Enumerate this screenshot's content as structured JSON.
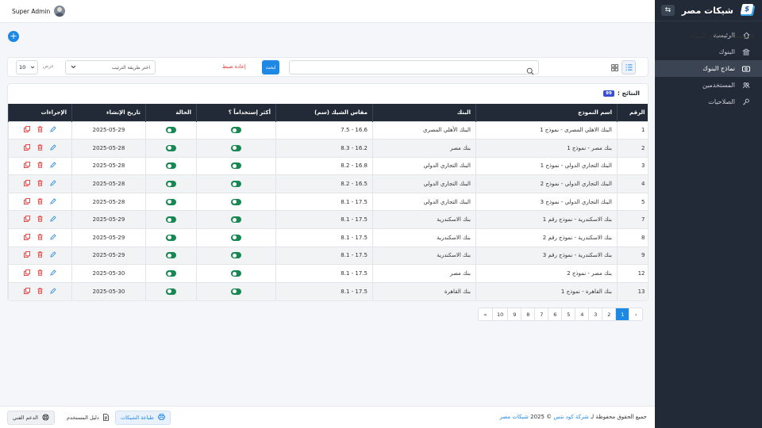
{
  "brand": {
    "name": "شيكات مصر"
  },
  "sidebar": {
    "items": [
      {
        "label": "الرئيسية",
        "icon": "home-icon"
      },
      {
        "label": "البنوك",
        "icon": "bank-icon"
      },
      {
        "label": "نماذج البنوك",
        "icon": "cheque-icon",
        "active": true
      },
      {
        "label": "المستخدمين",
        "icon": "users-icon"
      },
      {
        "label": "الصلاحيات",
        "icon": "key-icon"
      }
    ]
  },
  "topbar": {
    "user_name": "Super Admin"
  },
  "page": {
    "title": "الرئيسية - نماذج البنوك"
  },
  "filter": {
    "search_placeholder": "",
    "search_button": "ابحث",
    "reset": "إعادة ضبط",
    "sort_label": "اختر طريقة الترتيب",
    "show_label": "عرض",
    "per_page": "10"
  },
  "results": {
    "label": "النتائج :",
    "count": "99"
  },
  "table": {
    "headers": [
      "الرقم",
      "اسم النموذج",
      "البنك",
      "مقاس الشيك (سم)",
      "أكثر إستخداماً ؟",
      "الحالة",
      "تاريخ الإنشاء",
      "الإجراءات"
    ],
    "rows": [
      {
        "id": "1",
        "name": "البنك الاهلي المصرى - نموذج 1",
        "bank": "البنك الأهلي المصري",
        "size": "16.6 - 7.5",
        "date": "2025-05-29"
      },
      {
        "id": "2",
        "name": "بنك مصر - نموذج 1",
        "bank": "بنك مصر",
        "size": "16.2 - 8.3",
        "date": "2025-05-28"
      },
      {
        "id": "3",
        "name": "البنك التجاري الدولي - نموذج 1",
        "bank": "البنك التجاري الدولي",
        "size": "16.8 - 8.2",
        "date": "2025-05-28"
      },
      {
        "id": "4",
        "name": "البنك التجاري الدولي - نموذج 2",
        "bank": "البنك التجاري الدولي",
        "size": "16.5 - 8.2",
        "date": "2025-05-28"
      },
      {
        "id": "5",
        "name": "البنك التجاري الدولي - نموذج 3",
        "bank": "البنك التجاري الدولي",
        "size": "17.5 - 8.1",
        "date": "2025-05-28"
      },
      {
        "id": "7",
        "name": "بنك الاسكندرية - نموذج رقم 1",
        "bank": "بنك الاسكندرية",
        "size": "17.5 - 8.1",
        "date": "2025-05-29"
      },
      {
        "id": "8",
        "name": "بنك الاسكندرية - نموذج رقم 2",
        "bank": "بنك الاسكندرية",
        "size": "17.5 - 8.1",
        "date": "2025-05-29"
      },
      {
        "id": "9",
        "name": "بنك الاسكندرية - نموذج رقم 3",
        "bank": "بنك الاسكندرية",
        "size": "17.5 - 8.1",
        "date": "2025-05-29"
      },
      {
        "id": "12",
        "name": "بنك مصر - نموذج 2",
        "bank": "بنك مصر",
        "size": "17.5 - 8.1",
        "date": "2025-05-30"
      },
      {
        "id": "13",
        "name": "بنك القاهرة - نموذج 1",
        "bank": "بنك القاهرة",
        "size": "17.5 - 8.1",
        "date": "2025-05-30"
      }
    ]
  },
  "pagination": {
    "prev": "‹",
    "pages": [
      "1",
      "2",
      "3",
      "4",
      "5",
      "6",
      "7",
      "8",
      "9",
      "10"
    ],
    "next": "»",
    "current": "1"
  },
  "footer": {
    "copyright_prefix": "جميع الحقوق محفوظة لـ",
    "company": "شركة كود نتس",
    "year": "© 2025",
    "brand_link": "شيكات مصر",
    "print_cheques": "طباعة الشيكات",
    "user_guide": "دليل المستخدم",
    "support": "الدعم الفني"
  },
  "colors": {
    "accent": "#1e88e5",
    "sidebar": "#212a36",
    "toggle_on": "#198754",
    "danger": "#e53935"
  }
}
